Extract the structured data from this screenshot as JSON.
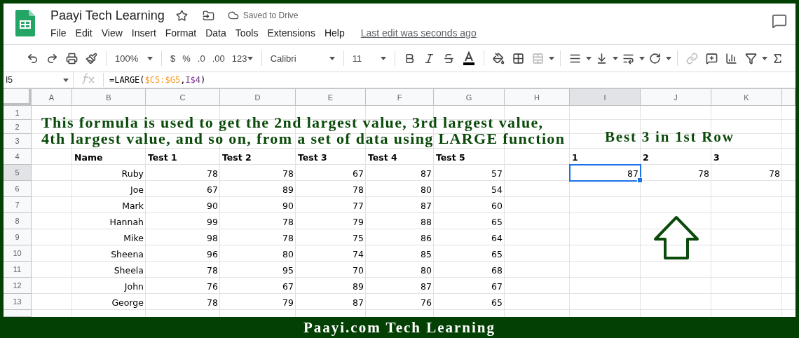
{
  "document": {
    "title": "Paayi Tech Learning",
    "save_status": "Saved to Drive",
    "last_edit": "Last edit was seconds ago"
  },
  "menu": [
    "File",
    "Edit",
    "View",
    "Insert",
    "Format",
    "Data",
    "Tools",
    "Extensions",
    "Help"
  ],
  "toolbar": {
    "zoom": "100%",
    "currency": "$",
    "percent": "%",
    "decrease_decimals": ".0",
    "increase_decimals": ".00",
    "number_format": "123",
    "font": "Calibri",
    "font_size": "11"
  },
  "formula_bar": {
    "cell": "I5",
    "parts": [
      {
        "text": "=LARGE(",
        "kind": "plain"
      },
      {
        "text": "$C5:$G5",
        "kind": "reference",
        "color": "#f7981d"
      },
      {
        "text": ",",
        "kind": "plain"
      },
      {
        "text": "I$4",
        "kind": "reference",
        "color": "#7e3794"
      },
      {
        "text": ")",
        "kind": "plain"
      }
    ]
  },
  "sheet": {
    "columns": [
      {
        "label": "A",
        "selected": false
      },
      {
        "label": "B",
        "selected": false
      },
      {
        "label": "C",
        "selected": false
      },
      {
        "label": "D",
        "selected": false
      },
      {
        "label": "E",
        "selected": false
      },
      {
        "label": "F",
        "selected": false
      },
      {
        "label": "G",
        "selected": false
      },
      {
        "label": "H",
        "selected": false
      },
      {
        "label": "I",
        "selected": true
      },
      {
        "label": "J",
        "selected": false
      },
      {
        "label": "K",
        "selected": false
      }
    ],
    "heading_lines": [
      "This formula is used to get the 2nd largest value, 3rd largest value,",
      "4th largest value, and so on, from a set of data using LARGE function"
    ],
    "side_heading": "Best 3 in 1st Row",
    "rows": [
      {
        "number": "1",
        "selected": false,
        "kind": "blank"
      },
      {
        "number": "2",
        "selected": false,
        "kind": "blank"
      },
      {
        "number": "3",
        "selected": false,
        "kind": "blank"
      },
      {
        "number": "4",
        "selected": false,
        "kind": "header",
        "cells": {
          "B": "Name",
          "C": "Test 1",
          "D": "Test 2",
          "E": "Test 3",
          "F": "Test 4",
          "G": "Test 5",
          "I": "1",
          "J": "2",
          "K": "3"
        }
      },
      {
        "number": "5",
        "selected": true,
        "kind": "data",
        "cells": {
          "B": "Ruby",
          "C": "78",
          "D": "78",
          "E": "67",
          "F": "87",
          "G": "57",
          "I": "87",
          "J": "78",
          "K": "78"
        }
      },
      {
        "number": "6",
        "selected": false,
        "kind": "data",
        "cells": {
          "B": "Joe",
          "C": "67",
          "D": "89",
          "E": "78",
          "F": "80",
          "G": "54"
        }
      },
      {
        "number": "7",
        "selected": false,
        "kind": "data",
        "cells": {
          "B": "Mark",
          "C": "90",
          "D": "90",
          "E": "77",
          "F": "87",
          "G": "60"
        }
      },
      {
        "number": "8",
        "selected": false,
        "kind": "data",
        "cells": {
          "B": "Hannah",
          "C": "99",
          "D": "78",
          "E": "79",
          "F": "88",
          "G": "65"
        }
      },
      {
        "number": "9",
        "selected": false,
        "kind": "data",
        "cells": {
          "B": "Mike",
          "C": "98",
          "D": "78",
          "E": "75",
          "F": "86",
          "G": "64"
        }
      },
      {
        "number": "10",
        "selected": false,
        "kind": "data",
        "cells": {
          "B": "Sheena",
          "C": "96",
          "D": "80",
          "E": "74",
          "F": "85",
          "G": "65"
        }
      },
      {
        "number": "11",
        "selected": false,
        "kind": "data",
        "cells": {
          "B": "Sheela",
          "C": "78",
          "D": "95",
          "E": "70",
          "F": "80",
          "G": "68"
        }
      },
      {
        "number": "12",
        "selected": false,
        "kind": "data",
        "cells": {
          "B": "John",
          "C": "76",
          "D": "67",
          "E": "89",
          "F": "87",
          "G": "67"
        }
      },
      {
        "number": "13",
        "selected": false,
        "kind": "data",
        "cells": {
          "B": "George",
          "C": "78",
          "D": "79",
          "E": "87",
          "F": "76",
          "G": "65"
        }
      }
    ]
  },
  "footer": {
    "text": "Paayi.com Tech Learning"
  }
}
